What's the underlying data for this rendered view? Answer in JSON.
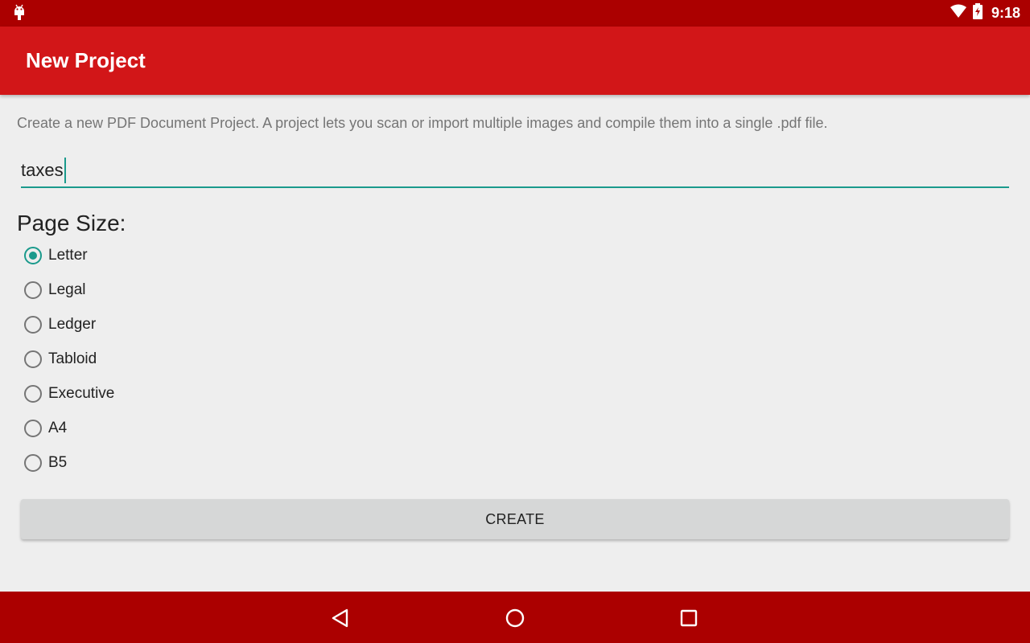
{
  "status_bar": {
    "time": "9:18",
    "icons": [
      "android-icon",
      "wifi-icon",
      "battery-icon"
    ]
  },
  "app_bar": {
    "title": "New Project"
  },
  "form": {
    "description": "Create a new PDF Document Project.  A project lets you scan or import multiple images and compile them into a single .pdf file.",
    "name_value": "taxes",
    "page_size_label": "Page Size:",
    "page_sizes": [
      "Letter",
      "Legal",
      "Ledger",
      "Tabloid",
      "Executive",
      "A4",
      "B5"
    ],
    "selected_page_size": "Letter",
    "create_label": "CREATE"
  },
  "nav_bar": {
    "icons": [
      "back-icon",
      "home-icon",
      "recents-icon"
    ]
  },
  "colors": {
    "status_bar": "#ab0000",
    "app_bar": "#d21618",
    "accent": "#1a9a8c",
    "background": "#eeeeee"
  }
}
